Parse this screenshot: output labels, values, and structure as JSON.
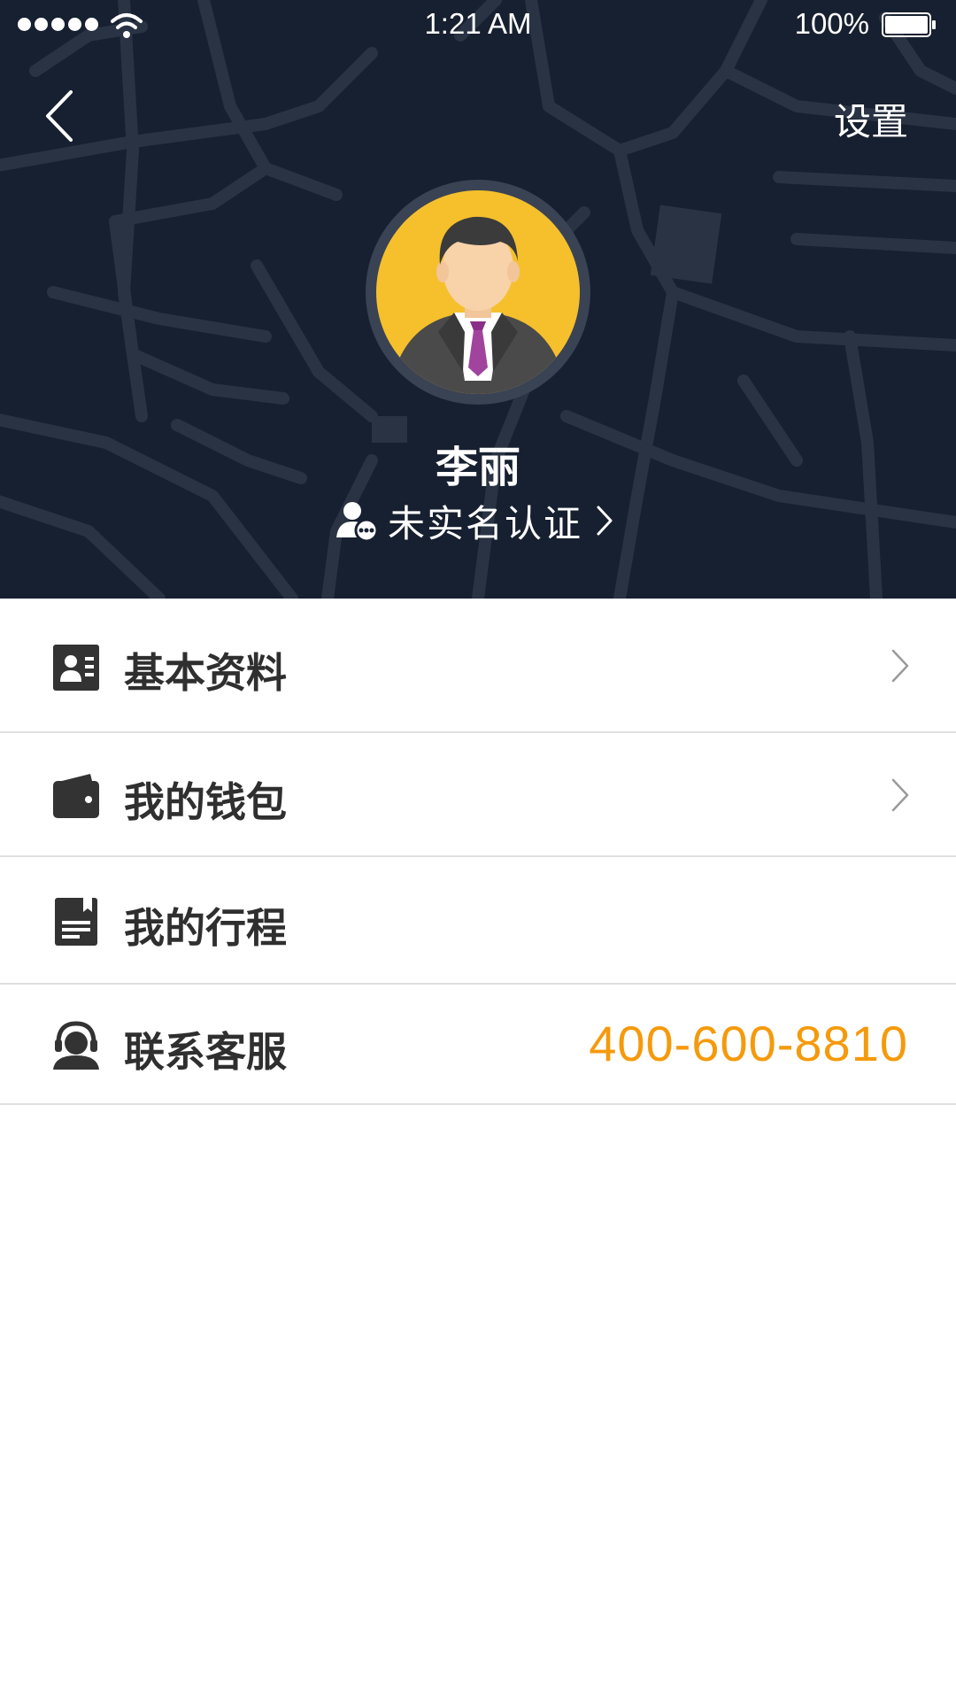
{
  "status_bar": {
    "time": "1:21 AM",
    "battery_percent": "100%",
    "signal_icon": "signal-dots-icon",
    "wifi_icon": "wifi-icon",
    "battery_icon": "battery-icon"
  },
  "header": {
    "back_icon": "chevron-left-icon",
    "settings_label": "设置",
    "avatar_icon": "businessman-avatar",
    "user_name": "李丽",
    "verify_label": "未实名认证",
    "verify_icon": "user-pending-icon"
  },
  "menu": {
    "items": [
      {
        "label": "基本资料",
        "icon": "profile-card-icon",
        "has_chevron": true
      },
      {
        "label": "我的钱包",
        "icon": "wallet-icon",
        "has_chevron": true
      },
      {
        "label": "我的行程",
        "icon": "itinerary-doc-icon",
        "has_chevron": false
      },
      {
        "label": "联系客服",
        "icon": "customer-service-icon",
        "value": "400-600-8810"
      }
    ]
  },
  "colors": {
    "header_bg": "#172030",
    "map_lines": "#2a3343",
    "avatar_bg": "#f5c02c",
    "accent_orange": "#f59a0c",
    "menu_text": "#2f2f2f",
    "divider": "#e0e0e0"
  }
}
